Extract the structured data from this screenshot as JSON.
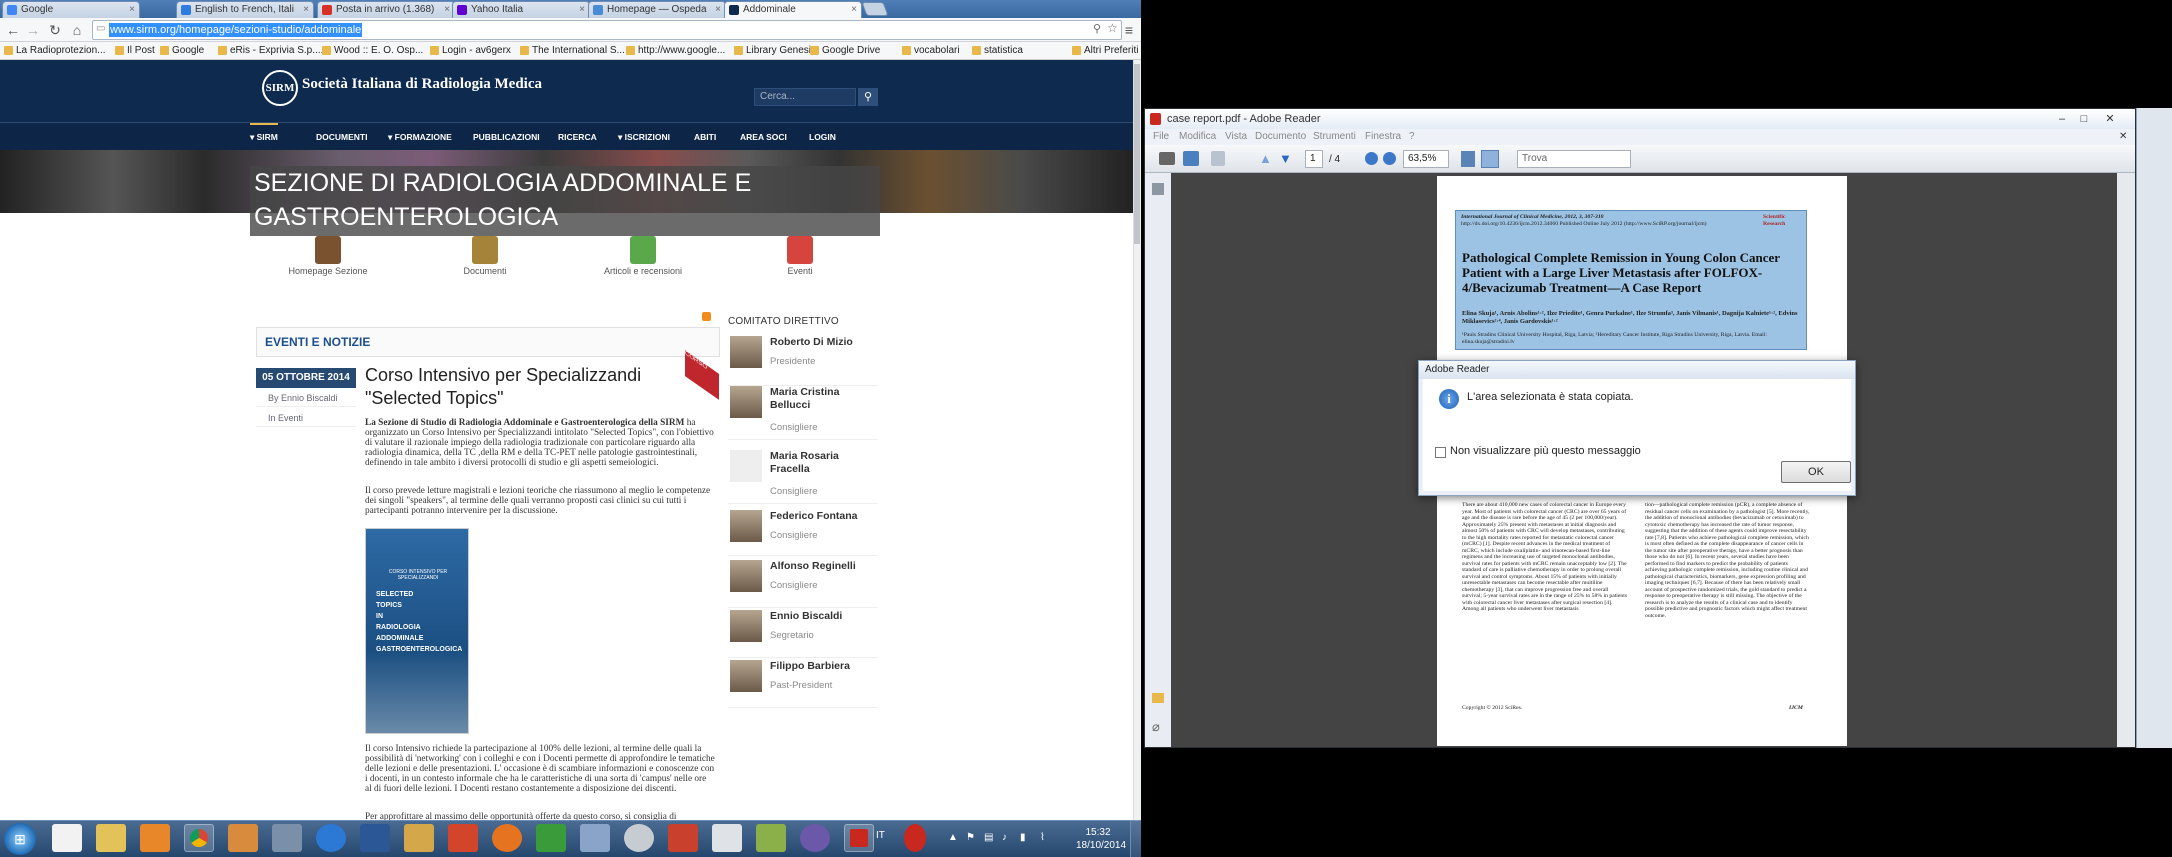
{
  "browser": {
    "tabs": [
      {
        "label": "Google",
        "color": "#4285f4"
      },
      {
        "label": "English to French, Itali",
        "color": "#2d7be0"
      },
      {
        "label": "Posta in arrivo (1.368)",
        "color": "#d93025"
      },
      {
        "label": "Yahoo Italia",
        "color": "#6001d2"
      },
      {
        "label": "Homepage — Ospeda",
        "color": "#4a8bd6"
      },
      {
        "label": "Addominale",
        "color": "#0e2a4e"
      }
    ],
    "url": "www.sirm.org/homepage/sezioni-studio/addominale",
    "bookmarks": [
      "La Radioprotezion...",
      "Il Post",
      "Google",
      "eRis - Exprivia S.p....",
      "Wood :: E. O. Osp...",
      "Login - av6gerx",
      "The International S...",
      "http://www.google...",
      "Library Genesis",
      "Google Drive",
      "vocabolari",
      "statistica"
    ],
    "other_bookmarks": "Altri Preferiti"
  },
  "site": {
    "logo_text": "SIRM",
    "name": "Società Italiana di Radiologia Medica",
    "search_placeholder": "Cerca...",
    "menu": [
      "SIRM",
      "DOCUMENTI",
      "FORMAZIONE",
      "PUBBLICAZIONI",
      "RICERCA",
      "ISCRIZIONI",
      "ABITI",
      "AREA SOCI",
      "LOGIN"
    ],
    "section_title": "SEZIONE DI RADIOLOGIA ADDOMINALE E GASTROENTEROLOGICA",
    "section_nav": [
      "Homepage Sezione",
      "Documenti",
      "Articoli e recensioni",
      "Eventi"
    ],
    "events_heading": "EVENTI E NOTIZIE",
    "date": "05 OTTOBRE 2014",
    "author": "By Ennio Biscaldi",
    "category": "In Eventi",
    "ribbon": "CORSO",
    "article_title": "Corso Intensivo per Specializzandi \"Selected Topics\"",
    "para1_bold": "La Sezione di Studio di Radiologia Addominale e Gastroenterologica della SIRM",
    "para1_rest": " ha organizzato un Corso Intensivo per Specializzandi intitolato \"Selected Topics\", con l'obiettivo di valutare il razionale impiego della radiologia tradizionale con particolare riguardo alla radiologia dinamica, della TC ,della RM e della TC-PET nelle patologie gastrointestinali, definendo in tale ambito i diversi protocolli di studio e gli aspetti semeiologici.",
    "para2": "Il corso prevede letture magistrali e lezioni teoriche che riassumono al meglio le competenze dei singoli \"speakers\", al termine delle quali verranno proposti casi clinici su cui tutti i partecipanti potranno intervenire per la discussione.",
    "poster_lines": [
      "SELECTED",
      "TOPICS",
      "IN",
      "RADIOLOGIA",
      "ADDOMINALE",
      "GASTROENTEROLOGICA"
    ],
    "poster_header": "CORSO INTENSIVO PER SPECIALIZZANDI",
    "para3": "Il corso Intensivo richiede la partecipazione al 100% delle lezioni, al termine delle quali la possibilità di 'networking' con i colleghi e con i Docenti permette di approfondire le tematiche delle lezioni e delle presentazioni. L' occasione è di scambiare informazioni e conoscenze con i docenti, in un contesto informale che ha le caratteristiche di una sorta di 'campus' nelle ore al di fuori delle lezioni. I Docenti restano costantemente a disposizione dei discenti.",
    "para4": "Per approfittare al massimo delle opportunità offerte da questo corso, si consiglia di",
    "committee_heading": "COMITATO DIRETTIVO",
    "committee": [
      {
        "name": "Roberto Di Mizio",
        "role": "Presidente"
      },
      {
        "name": "Maria Cristina Bellucci",
        "role": "Consigliere"
      },
      {
        "name": "Maria Rosaria Fracella",
        "role": "Consigliere"
      },
      {
        "name": "Federico Fontana",
        "role": "Consigliere"
      },
      {
        "name": "Alfonso Reginelli",
        "role": "Consigliere"
      },
      {
        "name": "Ennio Biscaldi",
        "role": "Segretario"
      },
      {
        "name": "Filippo Barbiera",
        "role": "Past-President"
      }
    ]
  },
  "reader": {
    "title": "case report.pdf - Adobe Reader",
    "menu": [
      "File",
      "Modifica",
      "Vista",
      "Documento",
      "Strumenti",
      "Finestra",
      "?"
    ],
    "page_current": "1",
    "page_total": "/ 4",
    "zoom": "63,5%",
    "find_placeholder": "Trova",
    "pdf": {
      "journal": "International Journal of Clinical Medicine, 2012, 3, 307-310",
      "doi": "http://dx.doi.org/10.4236/ijcm.2012.34060 Published Online July 2012 (http://www.SciRP.org/journal/ijcm)",
      "publisher": "Scientific Research",
      "title": "Pathological Complete Remission in Young Colon Cancer Patient with a Large Liver Metastasis after FOLFOX-4/Bevacizumab Treatment—A Case Report",
      "authors": "Elina Skuja¹, Arnis Abolins¹·², Ilze Priedite¹, Genra Purkalne¹, Ilze Strumfa³, Janis Vilmanis¹, Dagnija Kalniete¹·², Edvins Miklasevics²·⁴, Janis Gardovskis¹·²",
      "affil": "¹Pauls Stradins Clinical University Hospital, Riga, Latvia; ²Hereditary Cancer Institute, Riga Stradins University, Riga, Latvia. Email: elina.skuja@stradini.lv",
      "col1": "There are about 410,000 new cases of colorectal cancer in Europe every year. Most of patients with colorectal cancer (CRC) are over 65 years of age and the disease is rare before the age of 45 (2 per 100,000/year). Approximately 25% present with metastases at initial diagnosis and almost 50% of patients with CRC will develop metastases, contributing to the high mortality rates reported for metastatic colorectal cancer (mCRC) [1]. Despite recent advances in the medical treatment of mCRC, which include oxaliplatin- and irinotecan-based first-line regimens and the increasing use of targeted monoclonal antibodies, survival rates for patients with mCRC remain unacceptably low [2]. The standard of care is palliative chemotherapy in order to prolong overall survival and control symptoms. About 15% of patients with initially unresectable metastases can become resectable after multiline chemotherapy [3], that can improve progression free and overall survival; 5-year survival rates are in the range of 25% to 58% in patients with colorectal cancer liver metastases after surgical resection [4]. Among all patients who underwent liver metastasis",
      "col2": "tion—pathological complete remission (pCR), a complete absence of residual cancer cells on examination by a pathologist [5]. More recently, the addition of monoclonal antibodies (bevacizumab or cetuximab) to cytotoxic chemotherapy has increased the rate of tumor response, suggesting that the addition of these agents could improve resectability rate [7,8]. Patients who achieve pathological complete remission, which is most often defined as the complete disappearance of cancer cells in the tumor site after preoperative therapy, have a better prognosis than those who do not [6]. In recent years, several studies have been performed to find markers to predict the probability of patients achieving pathologic complete remission, including routine clinical and pathological characteristics, biomarkers, gene expression profiling and imaging techniques [6,7]. Because of there has been relatively small account of prospective randomized trials, the gold standard to predict a response to preoperative therapy is still missing. The objective of the research is to analyze the results of a clinical case and to identify possible predictive and prognostic factors which might affect treatment outcome.",
      "footer_left": "Copyright © 2012 SciRes.",
      "footer_right": "IJCM"
    }
  },
  "dialog": {
    "title": "Adobe Reader",
    "message": "L'area selezionata è stata copiata.",
    "checkbox_label": "Non visualizzare più questo messaggio",
    "ok_label": "OK"
  },
  "taskbar": {
    "language": "IT",
    "time": "15:32",
    "date": "18/10/2014"
  }
}
